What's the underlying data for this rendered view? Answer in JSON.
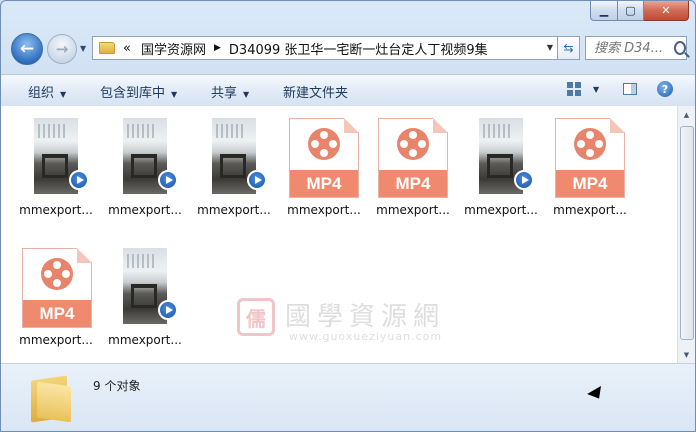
{
  "window": {
    "minimize_glyph": "▁",
    "maximize_glyph": "▢",
    "close_glyph": "✕"
  },
  "nav": {
    "back_glyph": "←",
    "forward_glyph": "→",
    "history_dropdown_glyph": "▼",
    "breadcrumb_overflow": "«",
    "breadcrumb": [
      "国学资源网",
      "D34099 张卫华一宅断一灶台定人丁视频9集"
    ],
    "breadcrumb_separator": "▶",
    "address_dropdown_glyph": "▼",
    "refresh_glyph": "⇆",
    "search_placeholder": "搜索 D34..."
  },
  "toolbar": {
    "organize": "组织",
    "include_library": "包含到库中",
    "share": "共享",
    "new_folder": "新建文件夹",
    "dropdown_glyph": "▼",
    "help_glyph": "?"
  },
  "files": [
    {
      "name": "mmexport...",
      "kind": "video-thumbnail"
    },
    {
      "name": "mmexport...",
      "kind": "video-thumbnail"
    },
    {
      "name": "mmexport...",
      "kind": "video-thumbnail"
    },
    {
      "name": "mmexport...",
      "kind": "mp4-icon"
    },
    {
      "name": "mmexport...",
      "kind": "mp4-icon"
    },
    {
      "name": "mmexport...",
      "kind": "video-thumbnail"
    },
    {
      "name": "mmexport...",
      "kind": "mp4-icon"
    },
    {
      "name": "mmexport...",
      "kind": "mp4-icon"
    },
    {
      "name": "mmexport...",
      "kind": "video-thumbnail"
    }
  ],
  "mp4_label": "MP4",
  "watermark": {
    "seal": "儒",
    "text": "國學資源網",
    "url": "www.guoxueziyuan.com"
  },
  "scrollbar": {
    "up_glyph": "▲",
    "down_glyph": "▼"
  },
  "status": {
    "count": "9 个对象"
  },
  "colors": {
    "mp4_accent": "#ef8a6f",
    "play_badge": "#1854a8",
    "close_button": "#c34a33"
  }
}
